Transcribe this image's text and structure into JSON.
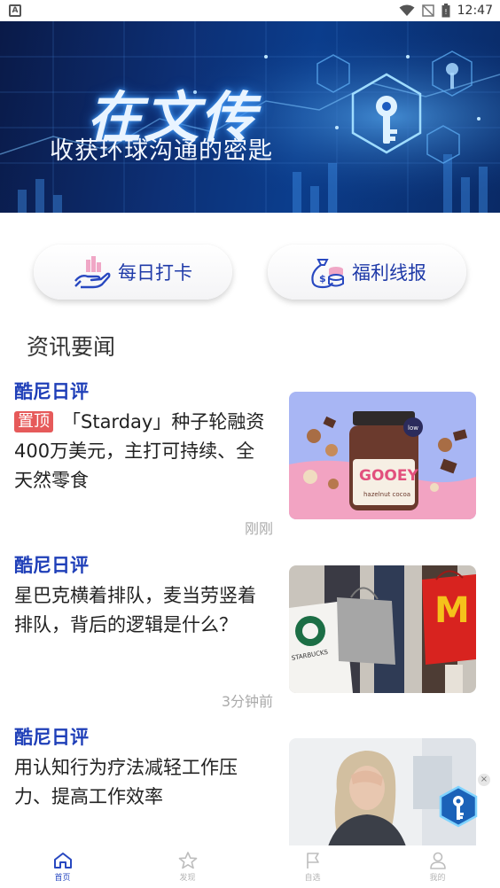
{
  "status_bar": {
    "notification_icon": "A",
    "time": "12:47",
    "icons": [
      "wifi-icon",
      "signal-off-icon",
      "battery-icon"
    ]
  },
  "banner": {
    "title": "在文传",
    "subtitle": "收获环球沟通的密匙",
    "accent_color": "#4aa3ff"
  },
  "actions": [
    {
      "label": "每日打卡",
      "icon": "hand-chart-icon"
    },
    {
      "label": "福利线报",
      "icon": "money-bag-icon"
    }
  ],
  "section": {
    "title": "资讯要闻"
  },
  "news": [
    {
      "source": "酷尼日评",
      "badge": "置顶",
      "text": "「Starday」种子轮融资400万美元，主打可持续、全天然零食",
      "time": "刚刚",
      "thumb": "cocoa-spread-jar-image"
    },
    {
      "source": "酷尼日评",
      "text": "星巴克横着排队，麦当劳竖着排队，背后的逻辑是什么？",
      "time": "3分钟前",
      "thumb": "shopping-bags-image"
    },
    {
      "source": "酷尼日评",
      "text": "用认知行为疗法减轻工作压力、提高工作效率",
      "thumb": "stressed-woman-image"
    }
  ],
  "floating": {
    "close": "×",
    "icon": "key-badge-icon"
  },
  "bottom_nav": [
    {
      "label": "首页",
      "icon": "home-icon",
      "active": true
    },
    {
      "label": "发现",
      "icon": "star-icon",
      "active": false
    },
    {
      "label": "自选",
      "icon": "flag-icon",
      "active": false
    },
    {
      "label": "我的",
      "icon": "person-icon",
      "active": false
    }
  ],
  "colors": {
    "brand_blue": "#1f3fb8",
    "pin_red": "#e65a5a",
    "nav_active": "#2848c0"
  }
}
